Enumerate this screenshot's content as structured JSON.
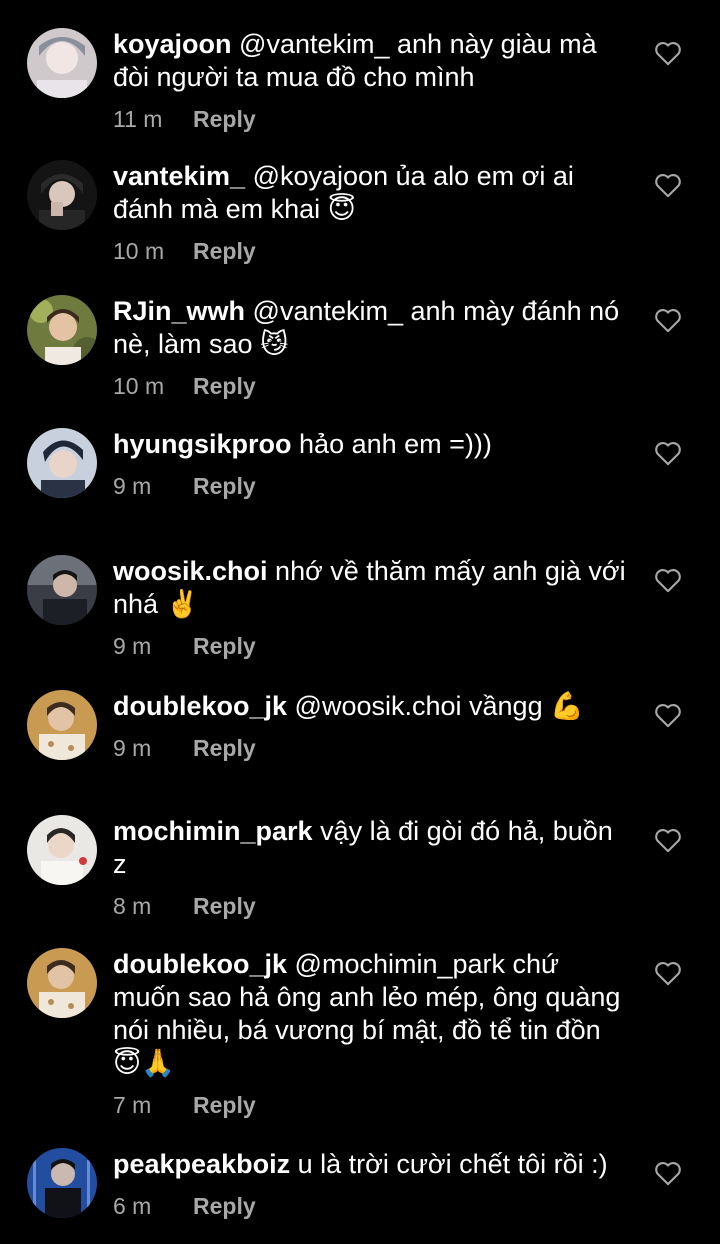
{
  "comments": [
    {
      "username": "koyajoon",
      "text": "@vantekim_ anh này giàu mà đòi người ta mua đồ cho mình",
      "time": "11 m",
      "reply": "Reply"
    },
    {
      "username": "vantekim_",
      "text": "@koyajoon ủa alo em ơi ai đánh mà em khai 😇",
      "time": "10 m",
      "reply": "Reply"
    },
    {
      "username": "RJin_wwh",
      "text": "@vantekim_ anh mày đánh nó nè, làm sao 😼",
      "time": "10 m",
      "reply": "Reply"
    },
    {
      "username": "hyungsikproo",
      "text": "hảo anh em =)))",
      "time": "9 m",
      "reply": "Reply"
    },
    {
      "username": "woosik.choi",
      "text": "nhớ về thăm mấy anh già với nhá ✌️",
      "time": "9 m",
      "reply": "Reply"
    },
    {
      "username": "doublekoo_jk",
      "text": "@woosik.choi vầngg 💪",
      "time": "9 m",
      "reply": "Reply"
    },
    {
      "username": "mochimin_park",
      "text": "vậy là đi gòi đó hả, buồn z",
      "time": "8 m",
      "reply": "Reply"
    },
    {
      "username": "doublekoo_jk",
      "text": "@mochimin_park chứ muốn sao hả ông anh lẻo mép, ông quàng nói nhiều, bá vương bí mật, đồ tể tin đồn 😇🙏",
      "time": "7 m",
      "reply": "Reply"
    },
    {
      "username": "peakpeakboiz",
      "text": "u là trời cười chết tôi rồi :)",
      "time": "6 m",
      "reply": "Reply"
    }
  ],
  "icons": {
    "like": "heart-outline-icon"
  },
  "colors": {
    "background": "#000000",
    "text": "#ffffff",
    "secondary": "#a8a8a8"
  }
}
